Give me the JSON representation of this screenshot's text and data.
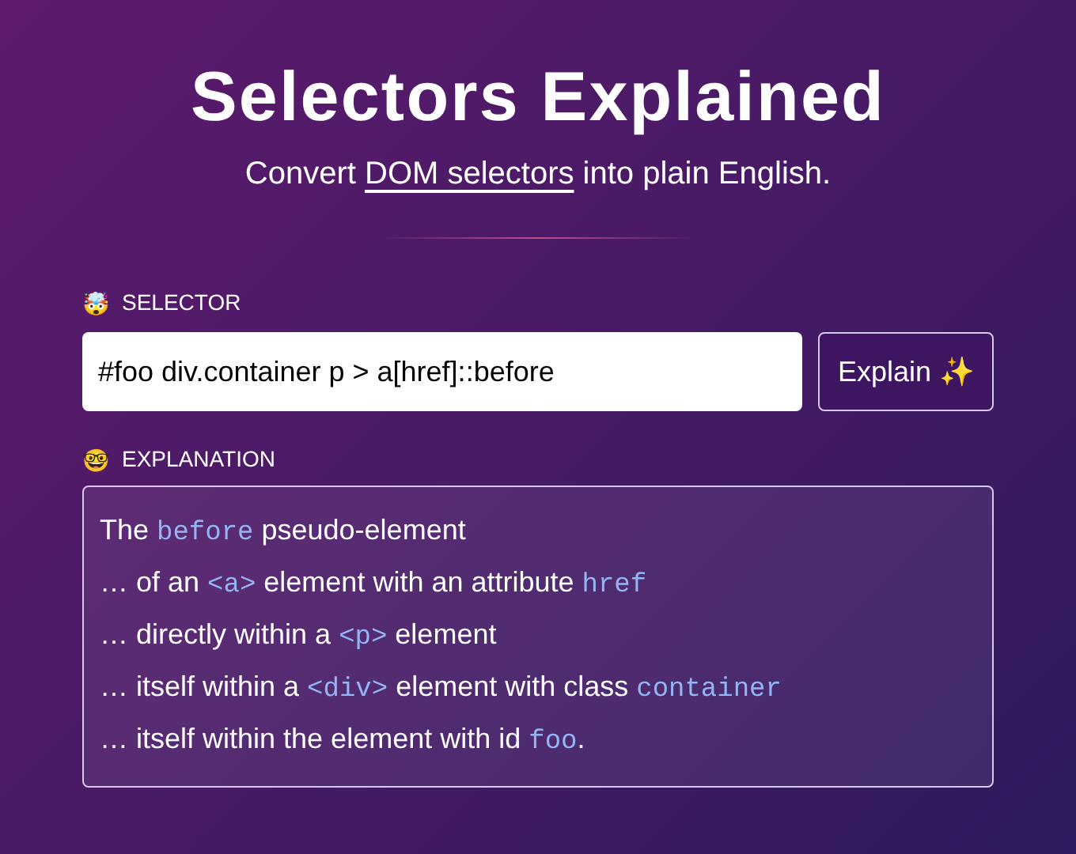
{
  "title": "Selectors Explained",
  "subtitle": {
    "before": "Convert ",
    "link": "DOM selectors",
    "after": " into plain English."
  },
  "selector": {
    "icon": "🤯",
    "label": "SELECTOR",
    "value": "#foo div.container p > a[href]::before",
    "button": "Explain ✨"
  },
  "explanation": {
    "icon": "🤓",
    "label": "EXPLANATION",
    "lines": [
      [
        {
          "kind": "text",
          "text": "The "
        },
        {
          "kind": "code",
          "text": "before"
        },
        {
          "kind": "text",
          "text": " pseudo-element"
        }
      ],
      [
        {
          "kind": "text",
          "text": "… of an "
        },
        {
          "kind": "code",
          "text": "<a>"
        },
        {
          "kind": "text",
          "text": " element with an attribute "
        },
        {
          "kind": "code",
          "text": "href"
        }
      ],
      [
        {
          "kind": "text",
          "text": "… directly within a "
        },
        {
          "kind": "code",
          "text": "<p>"
        },
        {
          "kind": "text",
          "text": " element"
        }
      ],
      [
        {
          "kind": "text",
          "text": "… itself within a "
        },
        {
          "kind": "code",
          "text": "<div>"
        },
        {
          "kind": "text",
          "text": " element with class "
        },
        {
          "kind": "code",
          "text": "container"
        }
      ],
      [
        {
          "kind": "text",
          "text": "… itself within the element with id "
        },
        {
          "kind": "code",
          "text": "foo"
        },
        {
          "kind": "text",
          "text": "."
        }
      ]
    ]
  }
}
